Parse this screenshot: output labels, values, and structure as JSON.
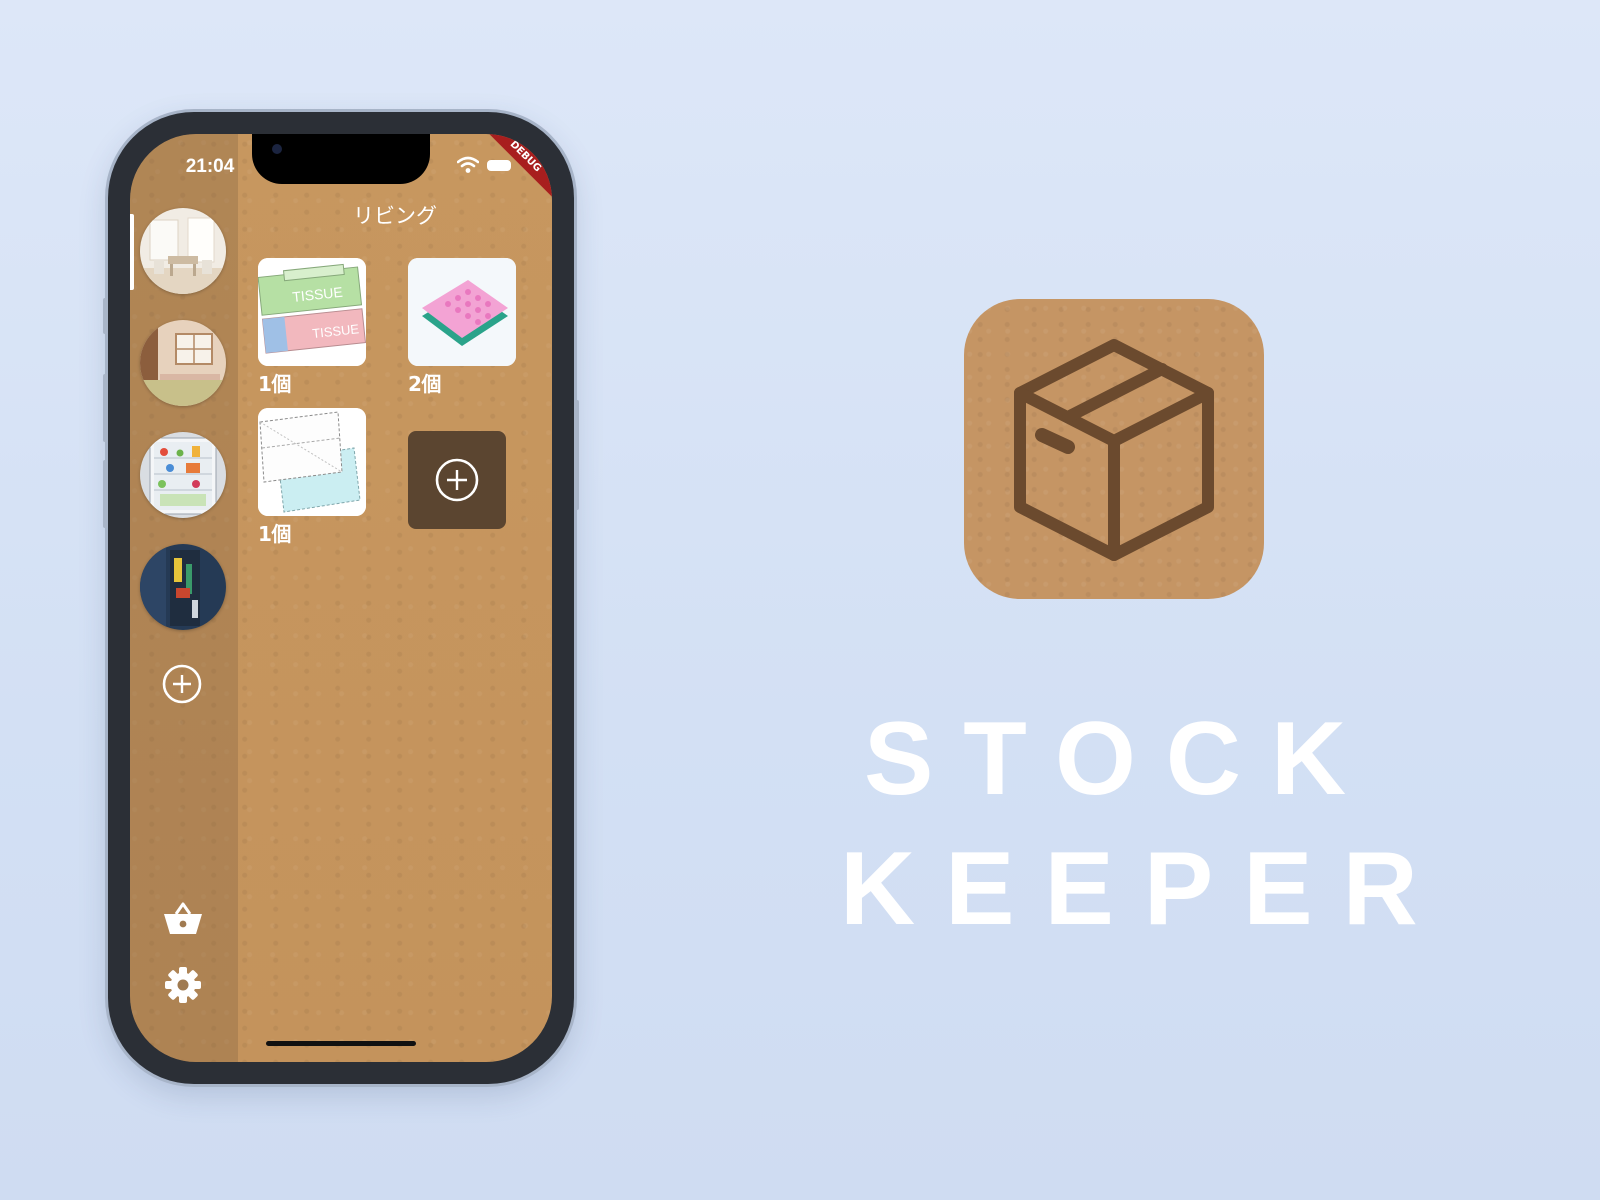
{
  "status_bar": {
    "time": "21:04",
    "debug_label": "DEBUG"
  },
  "room": {
    "title": "リビング"
  },
  "rooms": [
    {
      "name": "living-room"
    },
    {
      "name": "japanese-room"
    },
    {
      "name": "refrigerator"
    },
    {
      "name": "closet"
    }
  ],
  "items": [
    {
      "name": "tissue-boxes",
      "count": "1個"
    },
    {
      "name": "sponge",
      "count": "2個"
    },
    {
      "name": "masks",
      "count": "1個"
    }
  ],
  "tissue_text": "TISSUE",
  "icons": {
    "add_room": "plus-circle-icon",
    "add_item": "plus-circle-icon",
    "shopping": "basket-icon",
    "settings": "gear-icon",
    "app": "box-icon"
  },
  "colors": {
    "background": "#dde7f8",
    "kraft": "#c59564",
    "icon_brown": "#6b4a2e",
    "add_tile": "#5b4530",
    "text": "#ffffff"
  },
  "app": {
    "title_line1": "STOCK",
    "title_line2": "KEEPER"
  }
}
